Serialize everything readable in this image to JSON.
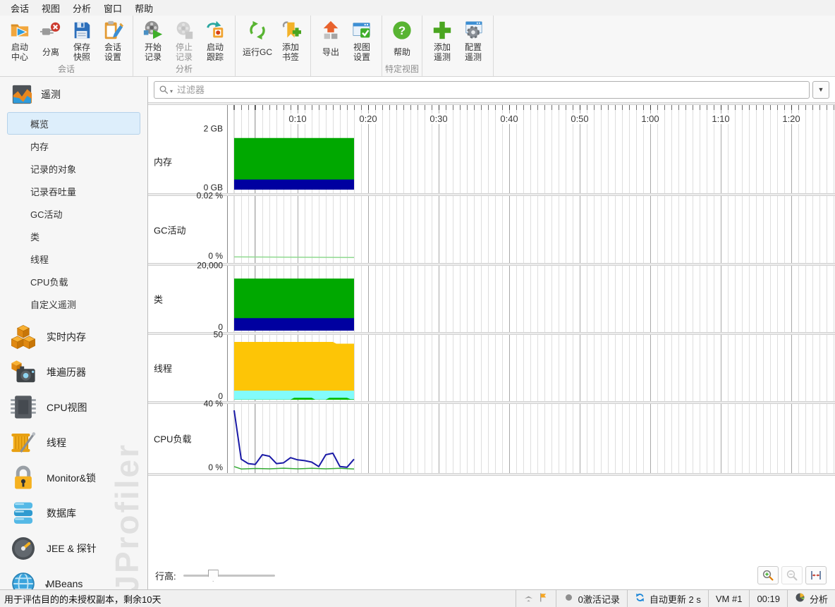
{
  "menu": {
    "items": [
      "会话",
      "视图",
      "分析",
      "窗口",
      "帮助"
    ]
  },
  "toolbar": {
    "groups": [
      {
        "label": "会话",
        "buttons": [
          {
            "label": "启动\n中心",
            "icon": "start-center-icon",
            "enabled": true
          },
          {
            "label": "分离",
            "icon": "detach-icon",
            "enabled": true
          },
          {
            "label": "保存\n快照",
            "icon": "save-snapshot-icon",
            "enabled": true
          },
          {
            "label": "会话\n设置",
            "icon": "session-settings-icon",
            "enabled": true
          }
        ]
      },
      {
        "label": "分析",
        "buttons": [
          {
            "label": "开始\n记录",
            "icon": "start-recording-icon",
            "enabled": true
          },
          {
            "label": "停止\n记录",
            "icon": "stop-recording-icon",
            "enabled": false
          },
          {
            "label": "启动\n跟踪",
            "icon": "start-tracking-icon",
            "enabled": true
          }
        ]
      },
      {
        "label": "",
        "buttons": [
          {
            "label": "运行GC",
            "icon": "run-gc-icon",
            "enabled": true
          },
          {
            "label": "添加\n书签",
            "icon": "add-bookmark-icon",
            "enabled": true
          }
        ]
      },
      {
        "label": "",
        "buttons": [
          {
            "label": "导出",
            "icon": "export-icon",
            "enabled": true
          },
          {
            "label": "视图\n设置",
            "icon": "view-settings-icon",
            "enabled": true
          }
        ]
      },
      {
        "label": "特定视图",
        "buttons": [
          {
            "label": "帮助",
            "icon": "help-icon",
            "enabled": true
          }
        ]
      },
      {
        "label": "",
        "buttons": [
          {
            "label": "添加\n遥测",
            "icon": "add-telemetry-icon",
            "enabled": true
          },
          {
            "label": "配置\n遥测",
            "icon": "configure-telemetry-icon",
            "enabled": true
          }
        ]
      }
    ]
  },
  "sidebar": {
    "section": {
      "label": "遥测",
      "icon": "telemetries-icon"
    },
    "sub_items": [
      {
        "label": "概览",
        "selected": true
      },
      {
        "label": "内存",
        "selected": false
      },
      {
        "label": "记录的对象",
        "selected": false
      },
      {
        "label": "记录吞吐量",
        "selected": false
      },
      {
        "label": "GC活动",
        "selected": false
      },
      {
        "label": "类",
        "selected": false
      },
      {
        "label": "线程",
        "selected": false
      },
      {
        "label": "CPU负载",
        "selected": false
      },
      {
        "label": "自定义遥测",
        "selected": false
      }
    ],
    "items": [
      {
        "label": "实时内存",
        "icon": "live-memory-icon"
      },
      {
        "label": "堆遍历器",
        "icon": "heap-walker-icon"
      },
      {
        "label": "CPU视图",
        "icon": "cpu-views-icon"
      },
      {
        "label": "线程",
        "icon": "threads-icon"
      },
      {
        "label": "Monitor&锁",
        "icon": "monitor-locks-icon"
      },
      {
        "label": "数据库",
        "icon": "databases-icon"
      },
      {
        "label": "JEE & 探针",
        "icon": "jee-probes-icon"
      },
      {
        "label": "MBeans",
        "icon": "mbeans-icon"
      }
    ],
    "watermark": "JProfiler"
  },
  "filter": {
    "placeholder": "过滤器"
  },
  "chart_data": {
    "type": "area",
    "x_axis": {
      "tick_labels": [
        "0:10",
        "0:20",
        "0:30",
        "0:40",
        "0:50",
        "1:00",
        "1:10",
        "1:20"
      ],
      "seconds_per_label": 10,
      "minor_tick_seconds": 1,
      "data_start_s": 1,
      "data_end_s": 18
    },
    "rows": [
      {
        "name": "内存",
        "max_label": "2 GB",
        "min_label": "0 GB",
        "ymax": 2,
        "h": 91,
        "top": 6,
        "base": 86,
        "series": [
          {
            "kind": "area",
            "color": "#00a800",
            "points": [
              [
                1,
                1.83
              ],
              [
                18,
                1.83
              ]
            ]
          },
          {
            "kind": "area",
            "color": "#0000a0",
            "points": [
              [
                1,
                0.36
              ],
              [
                18,
                0.36
              ]
            ]
          }
        ]
      },
      {
        "name": "GC活动",
        "max_label": "0.02 %",
        "min_label": "0 %",
        "ymax": 0.02,
        "h": 95,
        "top": 6,
        "base": 88,
        "series": [
          {
            "kind": "line",
            "color": "#8fd98f",
            "width": 1.5,
            "points": [
              [
                1,
                0.0004
              ],
              [
                18,
                0.0002
              ]
            ]
          }
        ]
      },
      {
        "name": "类",
        "max_label": "20,000",
        "min_label": "0",
        "ymax": 20000,
        "h": 94,
        "top": 9,
        "base": 92,
        "series": [
          {
            "kind": "area",
            "color": "#00a800",
            "points": [
              [
                1,
                17800
              ],
              [
                18,
                17800
              ]
            ]
          },
          {
            "kind": "area",
            "color": "#0000a0",
            "points": [
              [
                1,
                4300
              ],
              [
                18,
                4300
              ]
            ]
          }
        ]
      },
      {
        "name": "线程",
        "max_label": "50",
        "min_label": "0",
        "ymax": 50,
        "h": 94,
        "top": 8,
        "base": 92,
        "series": [
          {
            "kind": "area",
            "color": "#fdc506",
            "points": [
              [
                1,
                48.8
              ],
              [
                15,
                48.8
              ],
              [
                15.5,
                47.3
              ],
              [
                18,
                47.3
              ]
            ]
          },
          {
            "kind": "area",
            "color": "#82fbfb",
            "points": [
              [
                1,
                7.7
              ],
              [
                18,
                7.7
              ]
            ]
          },
          {
            "kind": "area",
            "color": "#00bb00",
            "points": [
              [
                1,
                0.2
              ],
              [
                9,
                0.2
              ],
              [
                9.5,
                1.6
              ],
              [
                12,
                1.6
              ],
              [
                12.5,
                0.2
              ],
              [
                14,
                0.2
              ],
              [
                14.5,
                1.6
              ],
              [
                17,
                1.6
              ],
              [
                17.5,
                0.4
              ],
              [
                18,
                0.4
              ]
            ]
          }
        ]
      },
      {
        "name": "CPU负载",
        "max_label": "40 %",
        "min_label": "0 %",
        "ymax": 40,
        "h": 98,
        "top": 9,
        "base": 93,
        "series": [
          {
            "kind": "line",
            "color": "#1a1aa6",
            "width": 2,
            "points": [
              [
                1,
                40
              ],
              [
                2,
                7
              ],
              [
                3,
                4
              ],
              [
                4,
                3.5
              ],
              [
                5,
                10
              ],
              [
                6,
                9
              ],
              [
                7,
                4
              ],
              [
                8,
                4.5
              ],
              [
                9,
                8
              ],
              [
                10,
                6.5
              ],
              [
                11,
                6
              ],
              [
                12,
                5
              ],
              [
                13,
                2
              ],
              [
                14,
                10
              ],
              [
                15,
                11
              ],
              [
                16,
                2
              ],
              [
                17,
                1.5
              ],
              [
                18,
                7
              ]
            ]
          },
          {
            "kind": "line",
            "color": "#33aa33",
            "width": 1.5,
            "points": [
              [
                1,
                2
              ],
              [
                2,
                0.4
              ],
              [
                4,
                0.7
              ],
              [
                6,
                0.5
              ],
              [
                8,
                0.9
              ],
              [
                10,
                0.5
              ],
              [
                12,
                0.8
              ],
              [
                14,
                0.5
              ],
              [
                16,
                0.8
              ],
              [
                18,
                0.4
              ]
            ]
          }
        ]
      }
    ]
  },
  "controls": {
    "row_height_label": "行高:"
  },
  "status_bar": {
    "license_text": "用于评估目的的未授权副本，剩余10天",
    "cells": [
      {
        "icons": [
          "plane-icon",
          "flag-icon"
        ],
        "text": ""
      },
      {
        "icons": [
          "record-circle-icon"
        ],
        "text": "0激活记录"
      },
      {
        "icons": [
          "refresh-icon"
        ],
        "text": "自动更新 2 s"
      },
      {
        "icons": [],
        "text": "VM #1"
      },
      {
        "icons": [],
        "text": "00:19"
      },
      {
        "icons": [
          "mode-pie-icon"
        ],
        "text": "分析"
      }
    ]
  }
}
